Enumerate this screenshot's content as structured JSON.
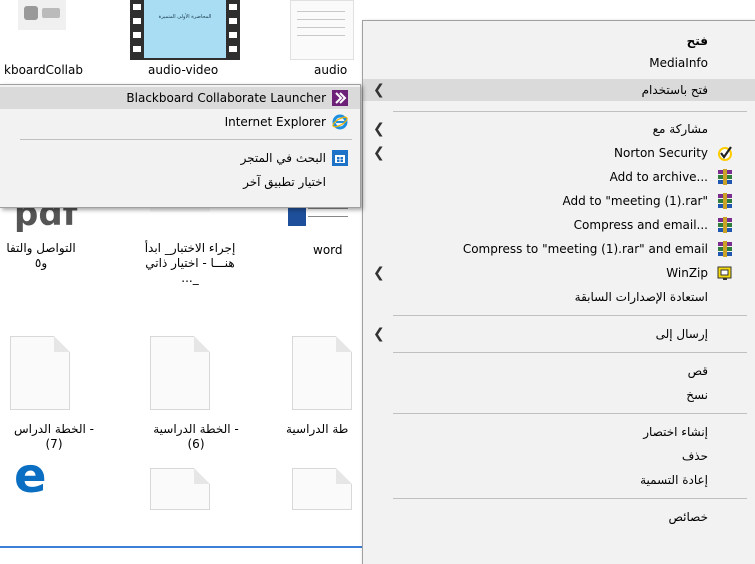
{
  "background": {
    "top_labels": [
      "kboardCollab",
      "audio-video",
      "audio"
    ],
    "video_thumb_title": "المحاضرة الأولى المتميزة",
    "row2_labels": [
      {
        "line1": "التواصل والتفا",
        "line2": "و٥"
      },
      {
        "line1": "إجراء الاختبار_ ابدأ",
        "line2": "هنـــا - اختيار ذاتي",
        "line3": "_..."
      },
      {
        "line1": "word"
      }
    ],
    "row3_labels": [
      {
        "line1": "- الخطة الدراس",
        "line2": "(7)"
      },
      {
        "line1": "- الخطة الدراسية",
        "line2": "(6)"
      },
      {
        "line1": "طة الدراسية"
      }
    ],
    "pdf_text": "pdf"
  },
  "context_menu": {
    "items": [
      {
        "label": "فتح",
        "bold": true
      },
      {
        "label": "MediaInfo"
      },
      {
        "label": "فتح باستخدام",
        "chevron": true,
        "highlighted": true
      },
      {
        "label": "مشاركة مع",
        "chevron": true
      },
      {
        "label": "Norton Security",
        "icon": "norton-check-icon",
        "chevron": true
      },
      {
        "label": "Add to archive...",
        "icon": "winrar-icon"
      },
      {
        "label": "Add to \"meeting (1).rar\"",
        "icon": "winrar-icon"
      },
      {
        "label": "Compress and email...",
        "icon": "winrar-icon"
      },
      {
        "label": "Compress to \"meeting (1).rar\" and email",
        "icon": "winrar-icon"
      },
      {
        "label": "WinZip",
        "icon": "winzip-icon",
        "chevron": true
      },
      {
        "label": "استعادة الإصدارات السابقة"
      },
      {
        "label": "إرسال إلى",
        "chevron": true
      },
      {
        "label": "قص"
      },
      {
        "label": "نسخ"
      },
      {
        "label": "إنشاء اختصار"
      },
      {
        "label": "حذف"
      },
      {
        "label": "إعادة التسمية"
      },
      {
        "label": "خصائص"
      }
    ]
  },
  "open_with_submenu": {
    "items": [
      {
        "label": "Blackboard Collaborate Launcher",
        "icon": "blackboard-launcher-icon",
        "highlighted": true
      },
      {
        "label": "Internet Explorer",
        "icon": "internet-explorer-icon"
      },
      {
        "label": "البحث في المتجر",
        "icon": "store-icon"
      },
      {
        "label": "اختيار تطبيق آخر"
      }
    ]
  },
  "colors": {
    "menu_bg": "#f2f2f2",
    "highlight": "#dadada",
    "blackboard_purple": "#6d2077",
    "ie_blue": "#1e90e0",
    "edge_blue": "#0a6fc2",
    "norton_yellow": "#ffcc00"
  }
}
